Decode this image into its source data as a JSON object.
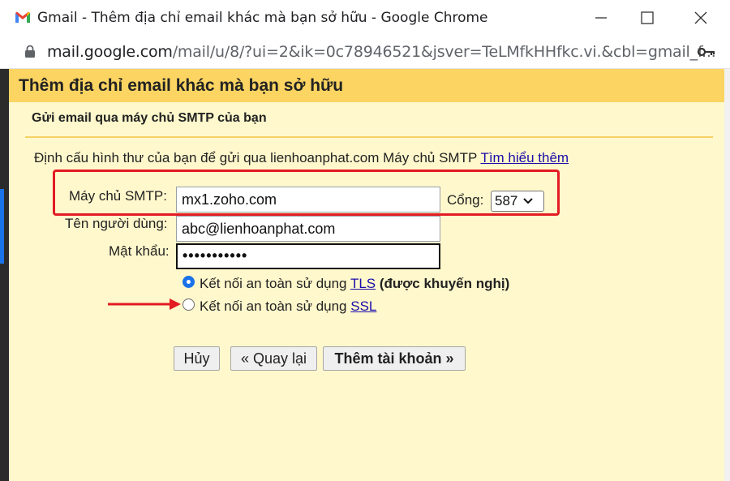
{
  "window": {
    "title": "Gmail - Thêm địa chỉ email khác mà bạn sở hữu - Google Chrome"
  },
  "address_bar": {
    "host": "mail.google.com",
    "path": "/mail/u/8/?ui=2&ik=0c78946521&jsver=TeLMfkHHfkc.vi.&cbl=gmail_f..."
  },
  "dialog": {
    "title": "Thêm địa chỉ email khác mà bạn sở hữu",
    "section_title": "Gửi email qua máy chủ SMTP của bạn",
    "description": "Định cấu hình thư của bạn để gửi qua lienhoanphat.com Máy chủ SMTP",
    "learn_more": "Tìm hiểu thêm",
    "smtp_label": "Máy chủ SMTP:",
    "smtp_value": "mx1.zoho.com",
    "port_label": "Cổng:",
    "port_value": "587",
    "username_label": "Tên người dùng:",
    "username_value": "abc@lienhoanphat.com",
    "password_label": "Mật khẩu:",
    "password_value": "•••••••••••",
    "tls_prefix": "Kết nối an toàn sử dụng ",
    "tls_link": "TLS",
    "tls_recommend": "(được khuyến nghị)",
    "ssl_prefix": "Kết nối an toàn sử dụng ",
    "ssl_link": "SSL",
    "cancel_label": "Hủy",
    "back_label": "« Quay lại",
    "add_label": "Thêm tài khoản »"
  },
  "colors": {
    "header": "#fcd462",
    "dialog_bg": "#fff8cc",
    "highlight": "#e31b23",
    "link": "#1a0dab"
  }
}
